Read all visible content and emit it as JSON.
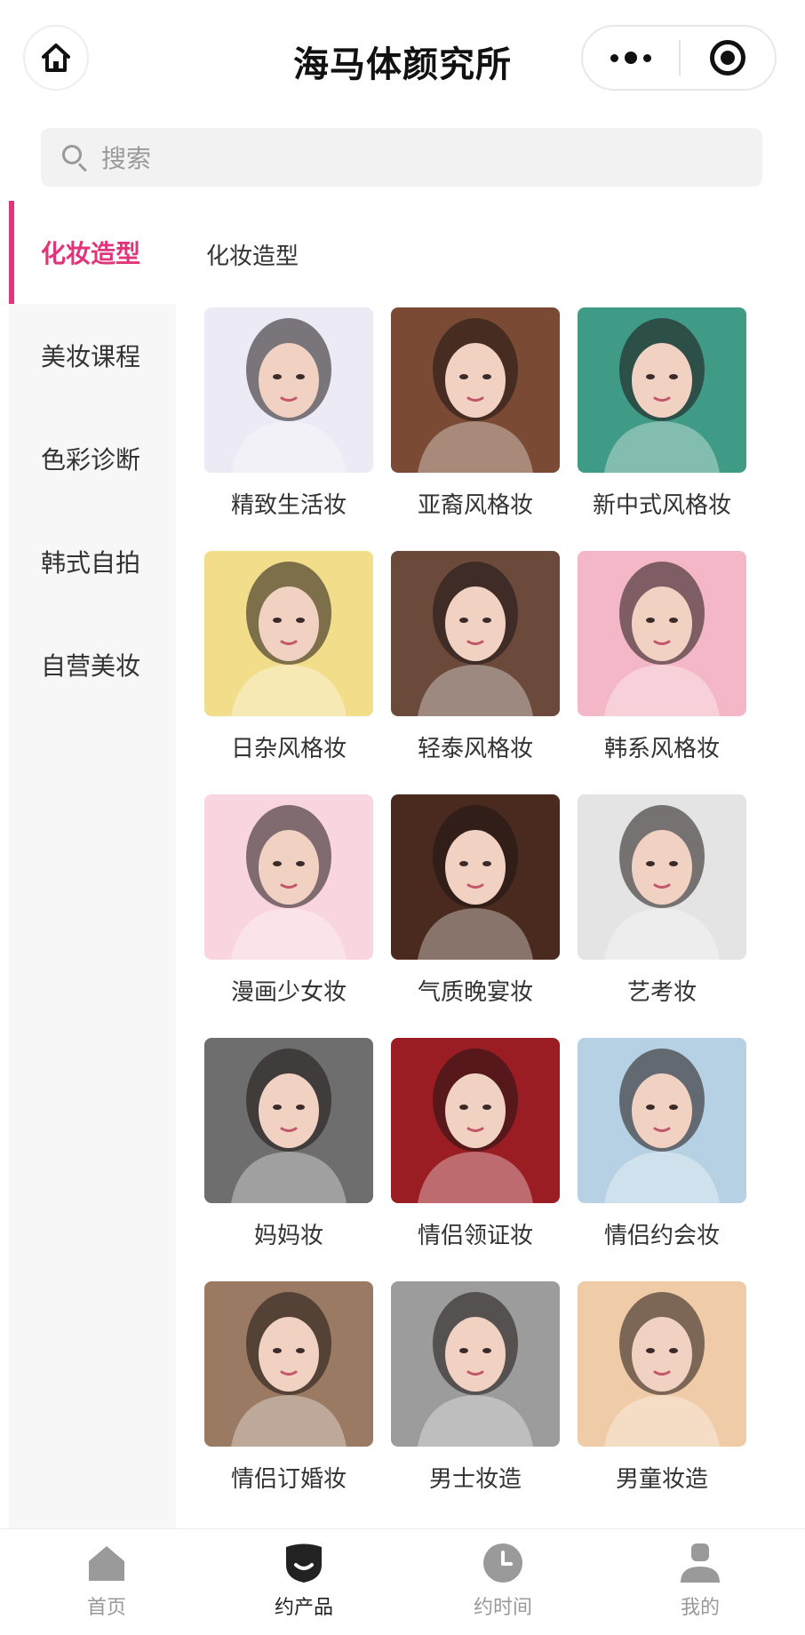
{
  "header": {
    "title": "海马体颜究所"
  },
  "search": {
    "placeholder": "搜索"
  },
  "sidebar": {
    "items": [
      {
        "label": "化妆造型"
      },
      {
        "label": "美妆课程"
      },
      {
        "label": "色彩诊断"
      },
      {
        "label": "韩式自拍"
      },
      {
        "label": "自营美妆"
      }
    ],
    "active_index": 0
  },
  "content": {
    "section_title": "化妆造型",
    "items": [
      {
        "label": "精致生活妆",
        "bg": "#eceaf5"
      },
      {
        "label": "亚裔风格妆",
        "bg": "#7a4a34"
      },
      {
        "label": "新中式风格妆",
        "bg": "#3f9a86"
      },
      {
        "label": "日杂风格妆",
        "bg": "#f1dd8a"
      },
      {
        "label": "轻泰风格妆",
        "bg": "#6b4a3c"
      },
      {
        "label": "韩系风格妆",
        "bg": "#f4b7c7"
      },
      {
        "label": "漫画少女妆",
        "bg": "#f9d5df"
      },
      {
        "label": "气质晚宴妆",
        "bg": "#4a2a1e"
      },
      {
        "label": "艺考妆",
        "bg": "#e4e4e4"
      },
      {
        "label": "妈妈妆",
        "bg": "#6e6e6e"
      },
      {
        "label": "情侣领证妆",
        "bg": "#9b1d24"
      },
      {
        "label": "情侣约会妆",
        "bg": "#b5d1e3"
      },
      {
        "label": "情侣订婚妆",
        "bg": "#9a7a63"
      },
      {
        "label": "男士妆造",
        "bg": "#9c9c9c"
      },
      {
        "label": "男童妆造",
        "bg": "#f0cba7"
      }
    ]
  },
  "tabbar": {
    "items": [
      {
        "label": "首页"
      },
      {
        "label": "约产品"
      },
      {
        "label": "约时间"
      },
      {
        "label": "我的"
      }
    ]
  },
  "colors": {
    "accent": "#e0357a",
    "sidebar_bg": "#f7f7f7",
    "tab_icon": "#9a9a9a"
  }
}
